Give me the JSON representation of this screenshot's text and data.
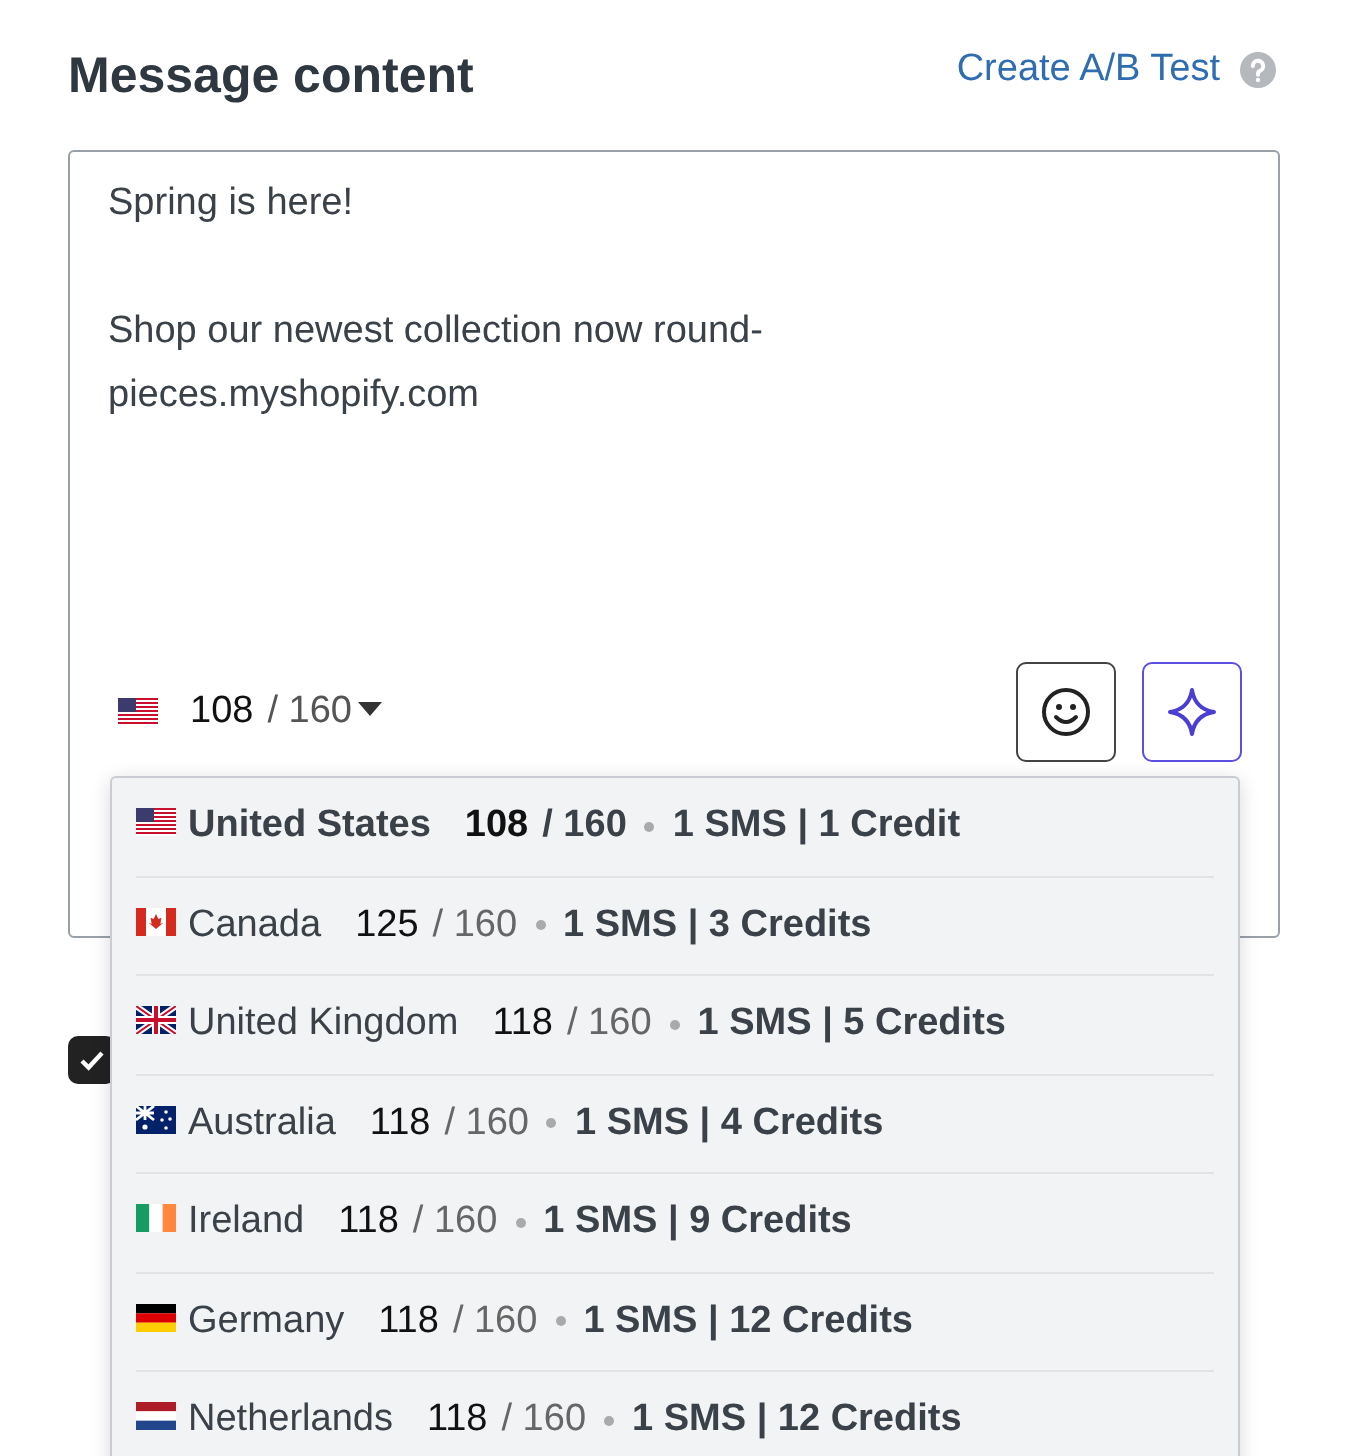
{
  "heading": "Message content",
  "ab_test_link": "Create A/B Test",
  "message": {
    "value": "Spring is here!\n\nShop our newest collection now round-pieces.myshopify.com",
    "counter": {
      "kind": "us",
      "count": "108",
      "limit": "/ 160"
    }
  },
  "checkbox": {
    "checked": true
  },
  "country_menu": [
    {
      "kind": "us",
      "country": "United States",
      "count": "108",
      "limit": "/ 160",
      "cost": "1 SMS | 1 Credit",
      "selected": true
    },
    {
      "kind": "ca",
      "country": "Canada",
      "count": "125",
      "limit": "/ 160",
      "cost": "1 SMS | 3 Credits",
      "selected": false
    },
    {
      "kind": "gb",
      "country": "United Kingdom",
      "count": "118",
      "limit": "/ 160",
      "cost": "1 SMS | 5 Credits",
      "selected": false
    },
    {
      "kind": "au",
      "country": "Australia",
      "count": "118",
      "limit": "/ 160",
      "cost": "1 SMS | 4 Credits",
      "selected": false
    },
    {
      "kind": "ie",
      "country": "Ireland",
      "count": "118",
      "limit": "/ 160",
      "cost": "1 SMS | 9 Credits",
      "selected": false
    },
    {
      "kind": "de",
      "country": "Germany",
      "count": "118",
      "limit": "/ 160",
      "cost": "1 SMS | 12 Credits",
      "selected": false
    },
    {
      "kind": "nl",
      "country": "Netherlands",
      "count": "118",
      "limit": "/ 160",
      "cost": "1 SMS | 12 Credits",
      "selected": false
    }
  ]
}
